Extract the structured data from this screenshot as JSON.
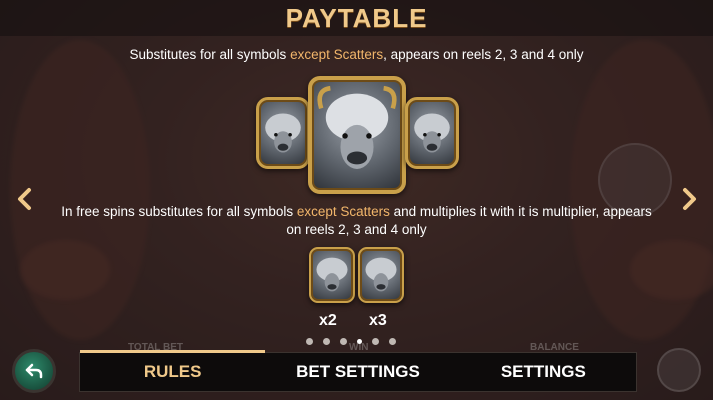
{
  "header": {
    "title": "PAYTABLE"
  },
  "description_1": {
    "part1": "Substitutes for all symbols ",
    "highlight": "except Scatters",
    "part2": ", appears on reels 2, 3 and 4 only"
  },
  "description_2": {
    "part1": "In free spins substitutes for all symbols ",
    "highlight": "except Scatters",
    "part2": " and multiplies it with it is multiplier, appears on reels 2, 3 and 4 only"
  },
  "multipliers": {
    "left": "x2",
    "right": "x3"
  },
  "ghost_labels": {
    "total_bet": "TOTAL BET",
    "win": "WIN",
    "balance": "BALANCE"
  },
  "pagination": {
    "pages": 6,
    "current": 4
  },
  "tabs": [
    "RULES",
    "BET SETTINGS",
    "SETTINGS"
  ],
  "active_tab": "RULES",
  "icons": {
    "prev": "chevron-left-icon",
    "next": "chevron-right-icon",
    "back": "back-arrow-icon"
  },
  "colors": {
    "accent": "#f0c98a",
    "highlight": "#f2b66b",
    "symbol_frame": "#c9a04a",
    "back_button": "#2e8a6b"
  }
}
